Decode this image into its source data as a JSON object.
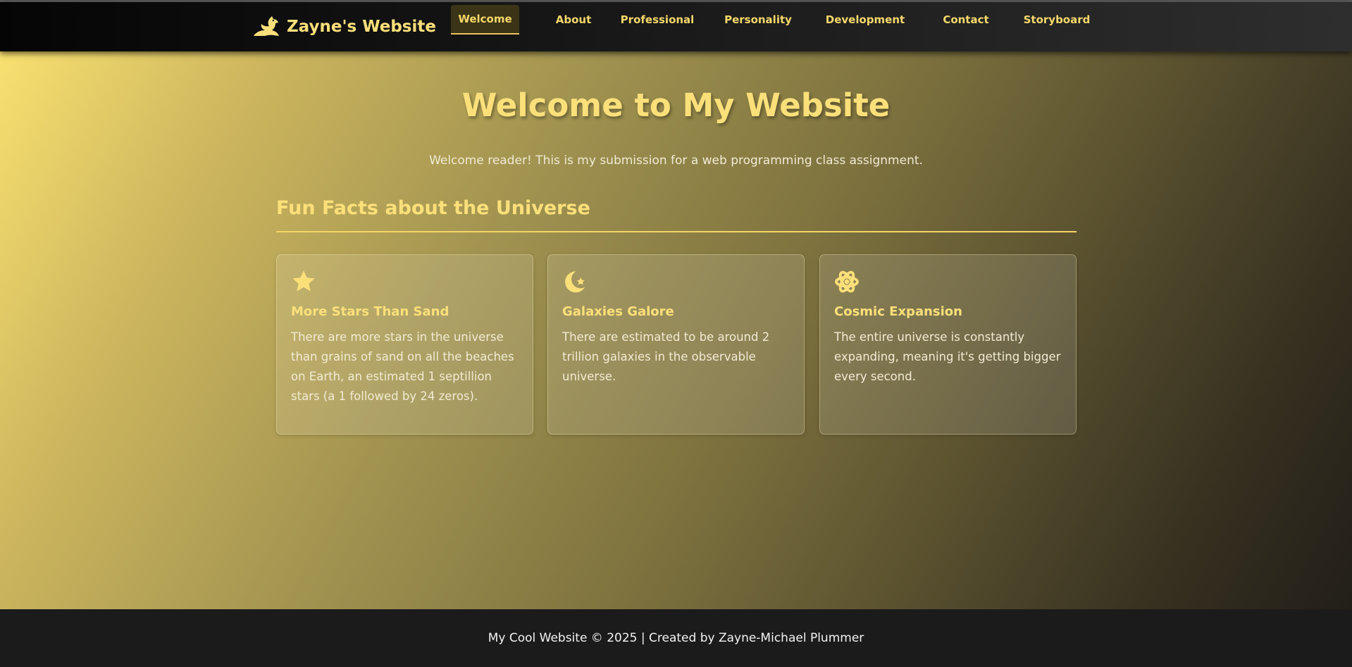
{
  "brand": {
    "name": "Zayne's Website",
    "icon": "dragon-icon"
  },
  "nav": {
    "items": [
      {
        "label": "Welcome",
        "active": true
      },
      {
        "label": "About",
        "active": false
      },
      {
        "label": "Professional",
        "active": false
      },
      {
        "label": "Personality",
        "active": false
      },
      {
        "label": "Development",
        "active": false
      },
      {
        "label": "Contact",
        "active": false
      },
      {
        "label": "Storyboard",
        "active": false
      }
    ]
  },
  "hero": {
    "title": "Welcome to My Website",
    "subtitle": "Welcome reader! This is my submission for a web programming class assignment."
  },
  "facts": {
    "heading": "Fun Facts about the Universe",
    "cards": [
      {
        "icon": "star-icon",
        "title": "More Stars Than Sand",
        "text": "There are more stars in the universe than grains of sand on all the beaches on Earth, an estimated 1 septillion stars (a 1 followed by 24 zeros)."
      },
      {
        "icon": "moon-star-icon",
        "title": "Galaxies Galore",
        "text": "There are estimated to be around 2 trillion galaxies in the observable universe."
      },
      {
        "icon": "atom-icon",
        "title": "Cosmic Expansion",
        "text": "The entire universe is constantly expanding, meaning it's getting bigger every second."
      }
    ]
  },
  "footer": {
    "text": "My Cool Website © 2025 | Created by Zayne-Michael Plummer"
  },
  "colors": {
    "accent": "#fbe07a",
    "header_bg": "#0a0a0a",
    "footer_bg": "#1b1b1b"
  }
}
